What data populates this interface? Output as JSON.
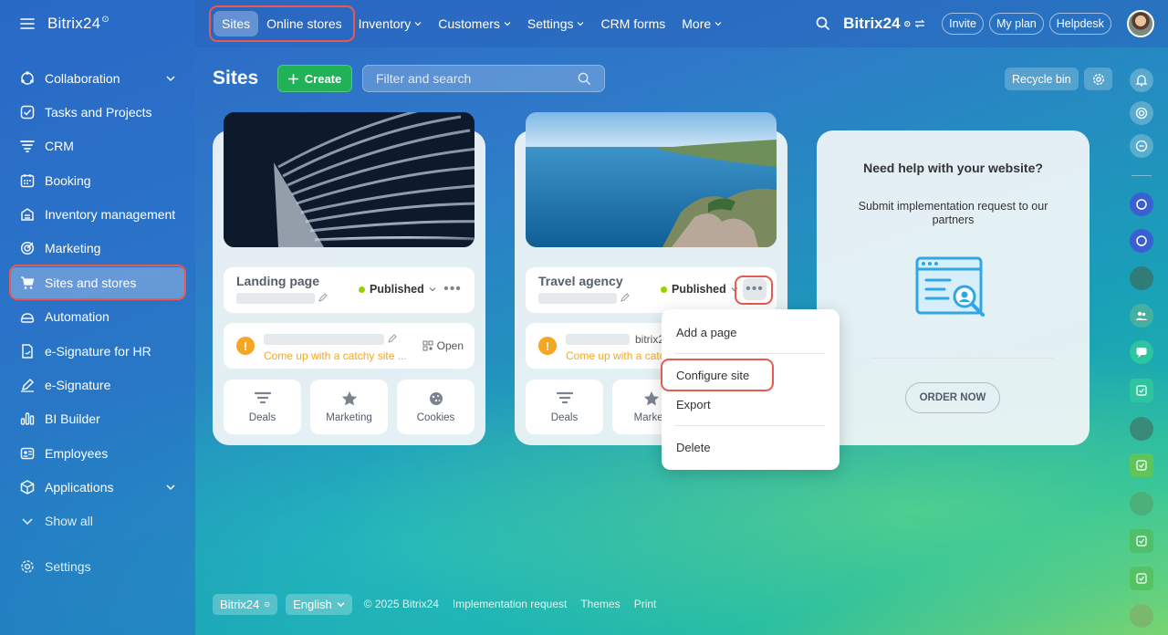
{
  "app": {
    "logo": "Bitrix24",
    "logo_mark": "⊙"
  },
  "sidebar": {
    "items": [
      {
        "label": "Collaboration",
        "icon": "collaboration-icon",
        "has_chevron": true
      },
      {
        "label": "Tasks and Projects",
        "icon": "tasks-icon"
      },
      {
        "label": "CRM",
        "icon": "crm-icon"
      },
      {
        "label": "Booking",
        "icon": "booking-icon"
      },
      {
        "label": "Inventory management",
        "icon": "inventory-icon"
      },
      {
        "label": "Marketing",
        "icon": "marketing-icon"
      },
      {
        "label": "Sites and stores",
        "icon": "cart-icon",
        "active": true
      },
      {
        "label": "Automation",
        "icon": "automation-icon"
      },
      {
        "label": "e-Signature for HR",
        "icon": "esignature-hr-icon"
      },
      {
        "label": "e-Signature",
        "icon": "pen-icon"
      },
      {
        "label": "BI Builder",
        "icon": "bi-icon"
      },
      {
        "label": "Employees",
        "icon": "employees-icon"
      },
      {
        "label": "Applications",
        "icon": "applications-icon",
        "has_chevron": true
      },
      {
        "label": "Show all",
        "icon": "chevron-down-icon"
      }
    ],
    "settings_label": "Settings"
  },
  "topbar": {
    "tabs": [
      {
        "label": "Sites",
        "selected": true
      },
      {
        "label": "Online stores"
      },
      {
        "label": "Inventory",
        "dropdown": true
      },
      {
        "label": "Customers",
        "dropdown": true
      },
      {
        "label": "Settings",
        "dropdown": true
      },
      {
        "label": "CRM forms"
      },
      {
        "label": "More",
        "dropdown": true
      }
    ],
    "brand": "Bitrix24",
    "invite": "Invite",
    "my_plan": "My plan",
    "helpdesk": "Helpdesk"
  },
  "toolbar": {
    "title": "Sites",
    "create_label": "Create",
    "search_placeholder": "Filter and search",
    "recycle_label": "Recycle bin"
  },
  "cards": [
    {
      "name": "Landing page",
      "status": "Published",
      "domain_suffix": "",
      "warning": "Come up with a catchy site ...",
      "open_label": "Open",
      "tiles": [
        "Deals",
        "Marketing",
        "Cookies"
      ]
    },
    {
      "name": "Travel agency",
      "status": "Published",
      "domain_suffix": "bitrix24",
      "warning": "Come up with a catc",
      "tiles": [
        "Deals",
        "Marketi"
      ]
    }
  ],
  "help": {
    "title": "Need help with your website?",
    "text": "Submit implementation request to our partners",
    "button": "ORDER NOW"
  },
  "menu": {
    "items": [
      "Add a page",
      "Configure site",
      "Export",
      "Delete"
    ]
  },
  "footer": {
    "brand_btn": "Bitrix24",
    "lang_btn": "English",
    "copyright": "© 2025 Bitrix24",
    "links": [
      "Implementation request",
      "Themes",
      "Print"
    ]
  },
  "colors": {
    "accent_green": "#1fb256",
    "highlight": "#e8594f",
    "status_green": "#9dcf00",
    "warning": "#f5a623"
  }
}
